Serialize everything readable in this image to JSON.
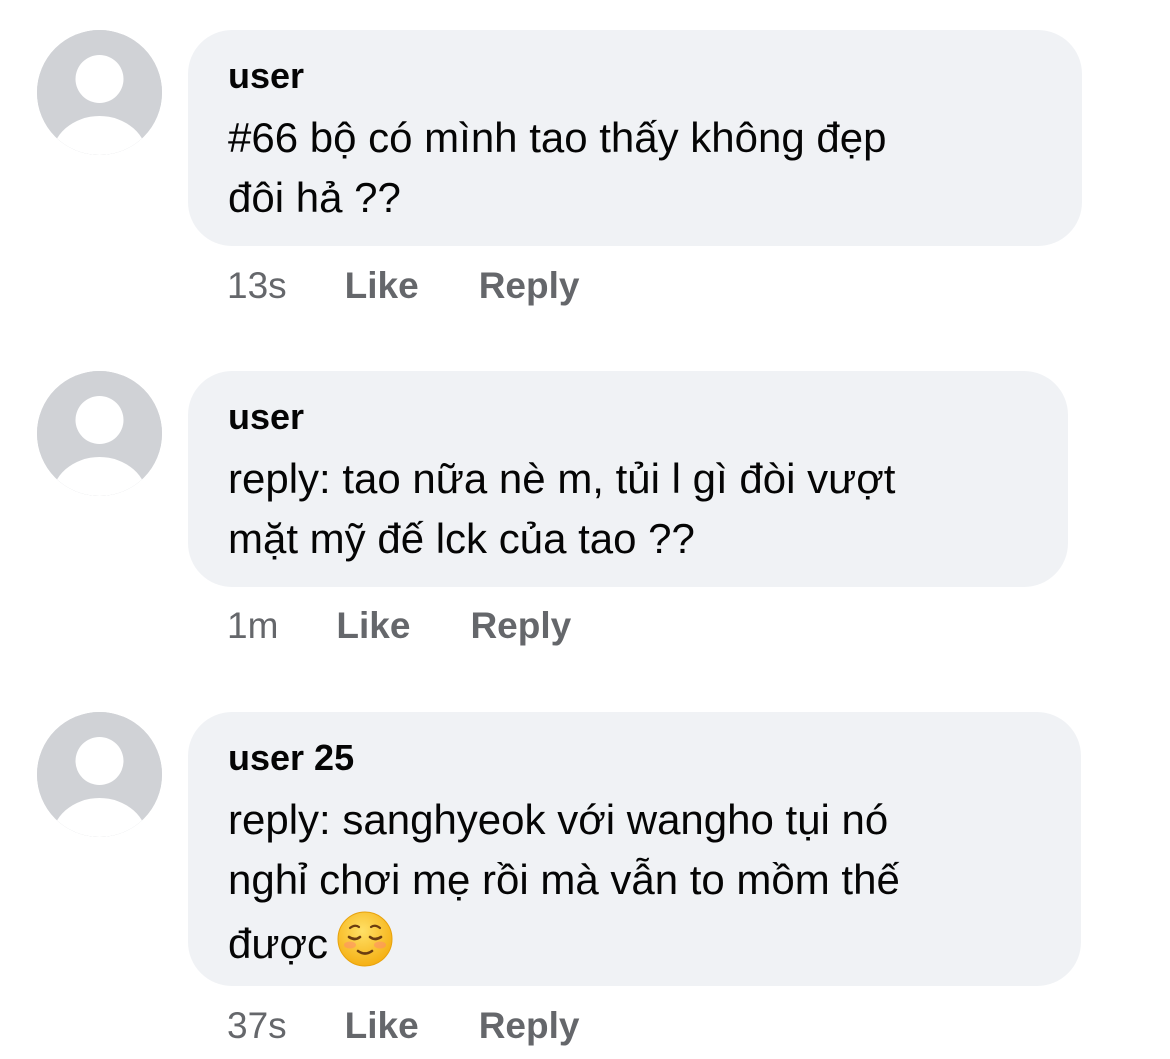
{
  "comments": [
    {
      "author": "user",
      "lines": [
        "#66 bộ có mình tao thấy không đẹp",
        "đôi hả ??"
      ],
      "time": "13s",
      "like_label": "Like",
      "reply_label": "Reply"
    },
    {
      "author": "user",
      "lines": [
        "reply: tao nữa nè m, tủi l gì đòi vượt",
        "mặt mỹ đế lck của tao ??"
      ],
      "time": "1m",
      "like_label": "Like",
      "reply_label": "Reply"
    },
    {
      "author": "user 25",
      "lines": [
        "reply: sanghyeok với wangho tụi nó",
        "nghỉ chơi mẹ rồi mà vẫn to mồm thế",
        "được"
      ],
      "emoji": "relieved-face-emoji",
      "time": "37s",
      "like_label": "Like",
      "reply_label": "Reply"
    }
  ],
  "colors": {
    "bubble": "#f0f2f5",
    "avatar": "#d0d2d6",
    "meta_text": "#65676b",
    "emoji_face": "#ffcc33"
  }
}
